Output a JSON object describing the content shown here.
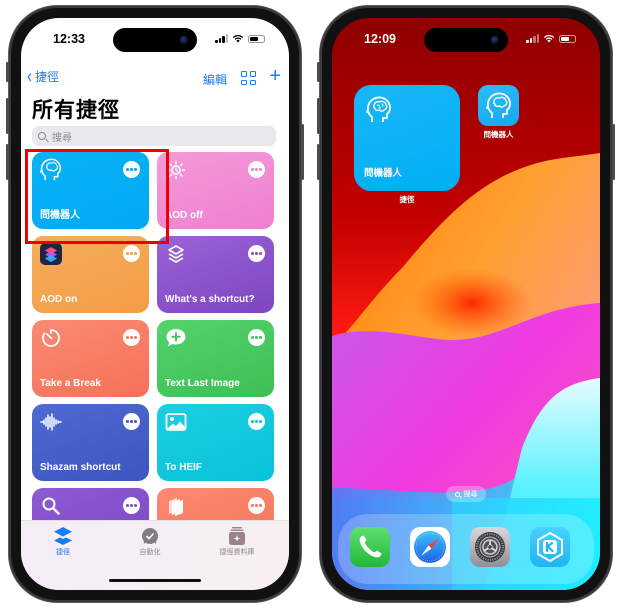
{
  "left_phone": {
    "status": {
      "time": "12:33"
    },
    "nav": {
      "back_label": "捷徑",
      "edit_label": "編輯"
    },
    "title": "所有捷徑",
    "search": {
      "placeholder": "搜尋"
    },
    "shortcuts": [
      {
        "label": "問機器人",
        "icon": "brain-head-icon",
        "color_from": "#08b2f6",
        "color_to": "#00a9f2",
        "dots": "#00a9f2",
        "highlighted": true
      },
      {
        "label": "AOD off",
        "icon": "sun-moon-icon",
        "color_from": "#f49ad8",
        "color_to": "#ee7fd1",
        "dots": "#ee86d3"
      },
      {
        "label": "AOD on",
        "icon": "shortcuts-app-icon",
        "color_from": "#f6ad5c",
        "color_to": "#f39d45",
        "dots": "#f4a24b"
      },
      {
        "label": "What's a shortcut?",
        "icon": "layers-icon",
        "color_from": "#9a63d6",
        "color_to": "#7f45c2",
        "dots": "#8a52cb"
      },
      {
        "label": "Take a Break",
        "icon": "timer-icon",
        "color_from": "#fb8a74",
        "color_to": "#f47157",
        "dots": "#f67c65"
      },
      {
        "label": "Text Last Image",
        "icon": "message-plus-icon",
        "color_from": "#55d26c",
        "color_to": "#3cbf55",
        "dots": "#46c75d"
      },
      {
        "label": "Shazam shortcut",
        "icon": "waveform-icon",
        "color_from": "#4f6ad3",
        "color_to": "#3c55c0",
        "dots": "#455fc9"
      },
      {
        "label": "To HEIF",
        "icon": "photo-icon",
        "color_from": "#1ccfe2",
        "color_to": "#07c2d9",
        "dots": "#10c8dd"
      },
      {
        "label": "",
        "icon": "search-icon",
        "color_from": "#8e5bd3",
        "color_to": "#7a45c4",
        "dots": "#8551cb"
      },
      {
        "label": "",
        "icon": "books-icon",
        "color_from": "#fb8a72",
        "color_to": "#f47358",
        "dots": "#f67d65"
      }
    ],
    "tabs": [
      {
        "label": "捷徑",
        "icon": "layers-icon",
        "active": true
      },
      {
        "label": "自動化",
        "icon": "clock-check-icon",
        "active": false
      },
      {
        "label": "捷徑資料庫",
        "icon": "gallery-icon",
        "active": false
      }
    ],
    "accent": "#1a7cf5",
    "highlight_color": "#ee0000"
  },
  "right_phone": {
    "status": {
      "time": "12:09"
    },
    "widget": {
      "label": "問機器人",
      "caption": "捷徑"
    },
    "app_icon": {
      "caption": "問機器人"
    },
    "search_pill": {
      "label": "搜尋"
    },
    "dock": [
      {
        "name": "Phone",
        "icon": "phone-icon"
      },
      {
        "name": "Safari",
        "icon": "safari-compass-icon"
      },
      {
        "name": "Settings",
        "icon": "settings-gear-icon"
      },
      {
        "name": "KKBOX",
        "icon": "kkbox-icon"
      }
    ]
  }
}
